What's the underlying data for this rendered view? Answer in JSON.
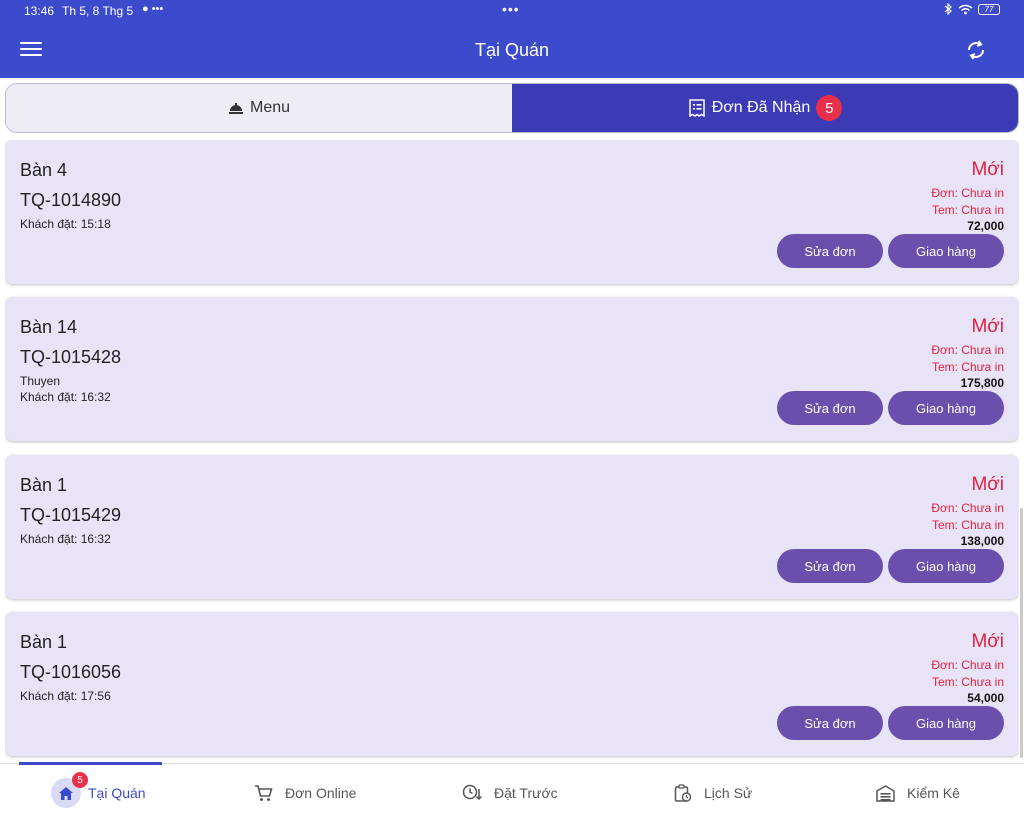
{
  "status_bar": {
    "time": "13:46",
    "date": "Th 5, 8 Thg 5",
    "battery": "77",
    "dots": "•••",
    "left_icons": "● •••"
  },
  "app_bar": {
    "title": "Tại Quán"
  },
  "tabs": {
    "menu_label": "Menu",
    "received_label": "Đơn Đã Nhận",
    "received_count": "5"
  },
  "orders": [
    {
      "table": "Bàn 4",
      "id": "TQ-1014890",
      "customer": "",
      "ordered_at": "Khách đặt: 15:18",
      "status": "Mới",
      "order_print": "Đơn: Chưa in",
      "label_print": "Tem: Chưa in",
      "total": "72,000",
      "edit_label": "Sửa đơn",
      "deliver_label": "Giao hàng"
    },
    {
      "table": "Bàn 14",
      "id": "TQ-1015428",
      "customer": "Thuyen",
      "ordered_at": "Khách đặt: 16:32",
      "status": "Mới",
      "order_print": "Đơn: Chưa in",
      "label_print": "Tem: Chưa in",
      "total": "175,800",
      "edit_label": "Sửa đơn",
      "deliver_label": "Giao hàng"
    },
    {
      "table": "Bàn 1",
      "id": "TQ-1015429",
      "customer": "",
      "ordered_at": "Khách đặt: 16:32",
      "status": "Mới",
      "order_print": "Đơn: Chưa in",
      "label_print": "Tem: Chưa in",
      "total": "138,000",
      "edit_label": "Sửa đơn",
      "deliver_label": "Giao hàng"
    },
    {
      "table": "Bàn 1",
      "id": "TQ-1016056",
      "customer": "",
      "ordered_at": "Khách đặt: 17:56",
      "status": "Mới",
      "order_print": "Đơn: Chưa in",
      "label_print": "Tem: Chưa in",
      "total": "54,000",
      "edit_label": "Sửa đơn",
      "deliver_label": "Giao hàng"
    }
  ],
  "bottom_nav": {
    "items": [
      {
        "label": "Tại Quán",
        "icon": "home-icon",
        "badge": "5",
        "active": true
      },
      {
        "label": "Đơn Online",
        "icon": "cart-icon"
      },
      {
        "label": "Đặt Trước",
        "icon": "clock-icon"
      },
      {
        "label": "Lịch Sử",
        "icon": "history-icon"
      },
      {
        "label": "Kiểm Kê",
        "icon": "warehouse-icon"
      }
    ]
  },
  "colors": {
    "primary": "#3c4bcc",
    "tab_active": "#3c3ab5",
    "card_bg": "#e9e3f7",
    "button": "#6a4fad",
    "status_red": "#e0223f",
    "badge": "#e8304a"
  }
}
